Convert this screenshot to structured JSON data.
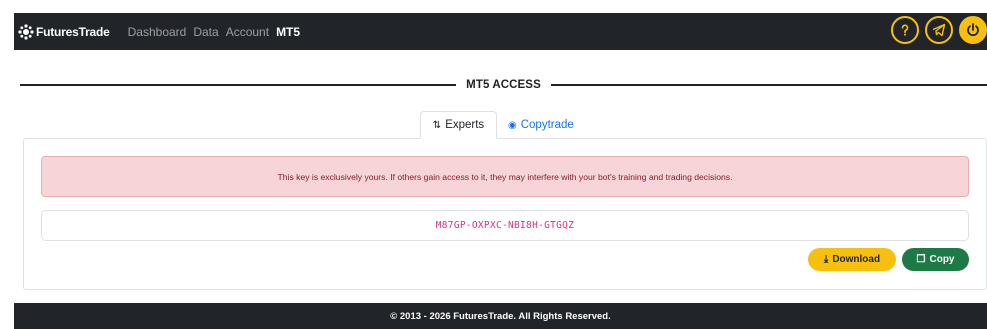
{
  "navbar": {
    "brand": "FuturesTrade",
    "links": [
      "Dashboard",
      "Data",
      "Account",
      "MT5"
    ],
    "icons": [
      "question-icon",
      "telegram-icon",
      "power-icon"
    ]
  },
  "section": {
    "title": "MT5 ACCESS"
  },
  "tabs": [
    {
      "label": "Experts",
      "icon": "sliders-icon"
    },
    {
      "label": "Copytrade",
      "icon": "eye-icon"
    }
  ],
  "alert": {
    "text": "This key is exclusively yours. If others gain access to it, they may interfere with your bot's training and trading decisions."
  },
  "key": {
    "value": "M87GP-OXPXC-NBI8H-GTGQZ"
  },
  "buttons": {
    "download": "Download",
    "copy": "Copy"
  },
  "colors": {
    "accent": "#f7c00e",
    "copy": "#1d7a47",
    "alert_bg": "#f6d4d7",
    "key_text": "#d63384"
  },
  "footer": {
    "text": "© 2013 - 2026 FuturesTrade. All Rights Reserved."
  }
}
